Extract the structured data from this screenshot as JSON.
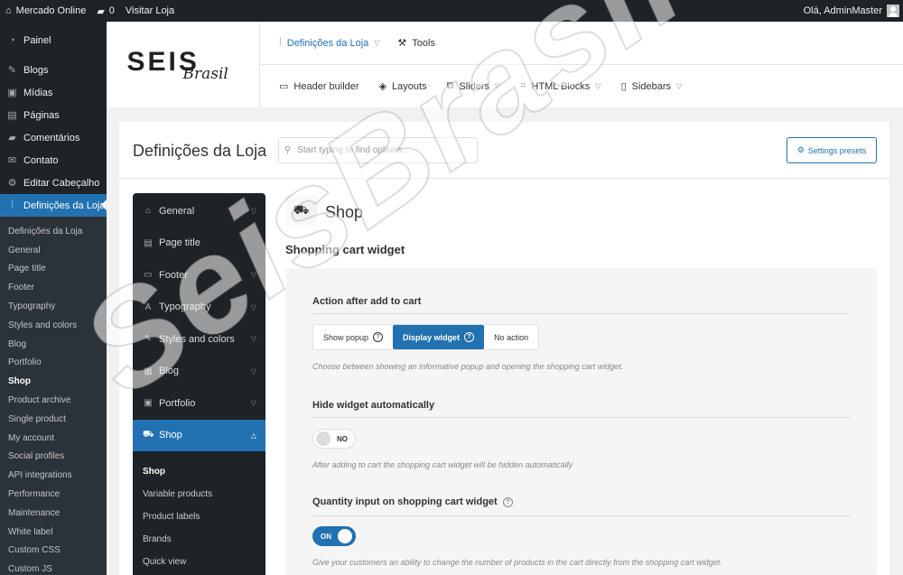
{
  "adminbar": {
    "site_name": "Mercado Online",
    "comments_count": "0",
    "visit_label": "Visitar Loja",
    "greeting": "Olá, AdminMaster"
  },
  "sidebar": {
    "items": [
      {
        "label": "Painel",
        "icon": "dashboard-icon"
      },
      {
        "label": "Blogs",
        "icon": "pin-icon"
      },
      {
        "label": "Mídias",
        "icon": "media-icon"
      },
      {
        "label": "Páginas",
        "icon": "page-icon"
      },
      {
        "label": "Comentários",
        "icon": "comment-icon"
      },
      {
        "label": "Contato",
        "icon": "mail-icon"
      },
      {
        "label": "Editar Cabeçalho",
        "icon": "gear-icon"
      },
      {
        "label": "Definições da Loja",
        "icon": "sliders-icon"
      }
    ],
    "sub": [
      "Definições da Loja",
      "General",
      "Page title",
      "Footer",
      "Typography",
      "Styles and colors",
      "Blog",
      "Portfolio",
      "Shop",
      "Product archive",
      "Single product",
      "My account",
      "Social profiles",
      "API integrations",
      "Performance",
      "Maintenance",
      "White label",
      "Custom CSS",
      "Custom JS"
    ]
  },
  "logo": {
    "main": "SEIS",
    "script": "Brasil"
  },
  "topnav": {
    "row1": [
      "Definições da Loja",
      "Tools"
    ],
    "row2": [
      "Header builder",
      "Layouts",
      "Sliders",
      "HTML Blocks",
      "Sidebars"
    ]
  },
  "panel": {
    "title": "Definições da Loja",
    "search_placeholder": "Start typing to find options...",
    "presets_label": "Settings presets"
  },
  "options": {
    "items": [
      "General",
      "Page title",
      "Footer",
      "Typography",
      "Styles and colors",
      "Blog",
      "Portfolio",
      "Shop"
    ],
    "shop_sub": [
      "Shop",
      "Variable products",
      "Product labels",
      "Brands",
      "Quick view"
    ]
  },
  "content": {
    "title": "Shop",
    "section": "Shopping cart widget",
    "f1": {
      "label": "Action after add to cart",
      "options": [
        "Show popup",
        "Display widget",
        "No action"
      ],
      "selected": "Display widget",
      "hint": "Choose between showing an informative popup and opening the shopping cart widget."
    },
    "f2": {
      "label": "Hide widget automatically",
      "toggle": "NO",
      "hint": "After adding to cart the shopping cart widget will be hidden automatically"
    },
    "f3": {
      "label": "Quantity input on shopping cart widget",
      "toggle": "ON",
      "hint": "Give your customers an ability to change the number of products in the cart directly from the shopping cart widget."
    }
  },
  "watermark": "SeisBrasil",
  "colors": {
    "accent": "#2271b1",
    "admin_dark": "#1d2327"
  }
}
